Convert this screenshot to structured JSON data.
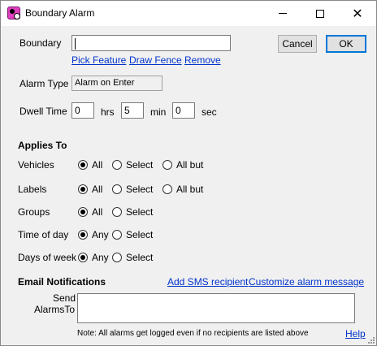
{
  "window": {
    "title": "Boundary Alarm",
    "icon": "boundary-alarm-app-icon",
    "close_glyph": "✕"
  },
  "boundary": {
    "label": "Boundary",
    "value": "",
    "pick_feature": "Pick Feature",
    "draw_fence": "Draw Fence",
    "remove": "Remove"
  },
  "buttons": {
    "cancel": "Cancel",
    "ok": "OK"
  },
  "alarm_type": {
    "label": "Alarm Type",
    "value": "Alarm on Enter"
  },
  "dwell": {
    "label": "Dwell Time",
    "hrs_value": "0",
    "hrs_unit": "hrs",
    "min_value": "5",
    "min_unit": "min",
    "sec_value": "0",
    "sec_unit": "sec"
  },
  "applies_to": {
    "heading": "Applies To",
    "rows": {
      "vehicles": {
        "label": "Vehicles",
        "opt1": "All",
        "opt2": "Select",
        "opt3": "All but",
        "selected": "All"
      },
      "labels": {
        "label": "Labels",
        "opt1": "All",
        "opt2": "Select",
        "opt3": "All but",
        "selected": "All"
      },
      "groups": {
        "label": "Groups",
        "opt1": "All",
        "opt2": "Select",
        "selected": "All"
      },
      "time_of_day": {
        "label": "Time of day",
        "opt1": "Any",
        "opt2": "Select",
        "selected": "Any"
      },
      "days_of_week": {
        "label": "Days of week",
        "opt1": "Any",
        "opt2": "Select",
        "selected": "Any"
      }
    }
  },
  "email": {
    "heading": "Email Notifications",
    "add_sms": "Add SMS recipient",
    "customize": "Customize alarm message",
    "send_label_1": "Send",
    "send_label_2": "AlarmsTo",
    "recipients_value": "",
    "note": "Note: All alarms get logged even if no recipients are listed above",
    "help": "Help"
  }
}
